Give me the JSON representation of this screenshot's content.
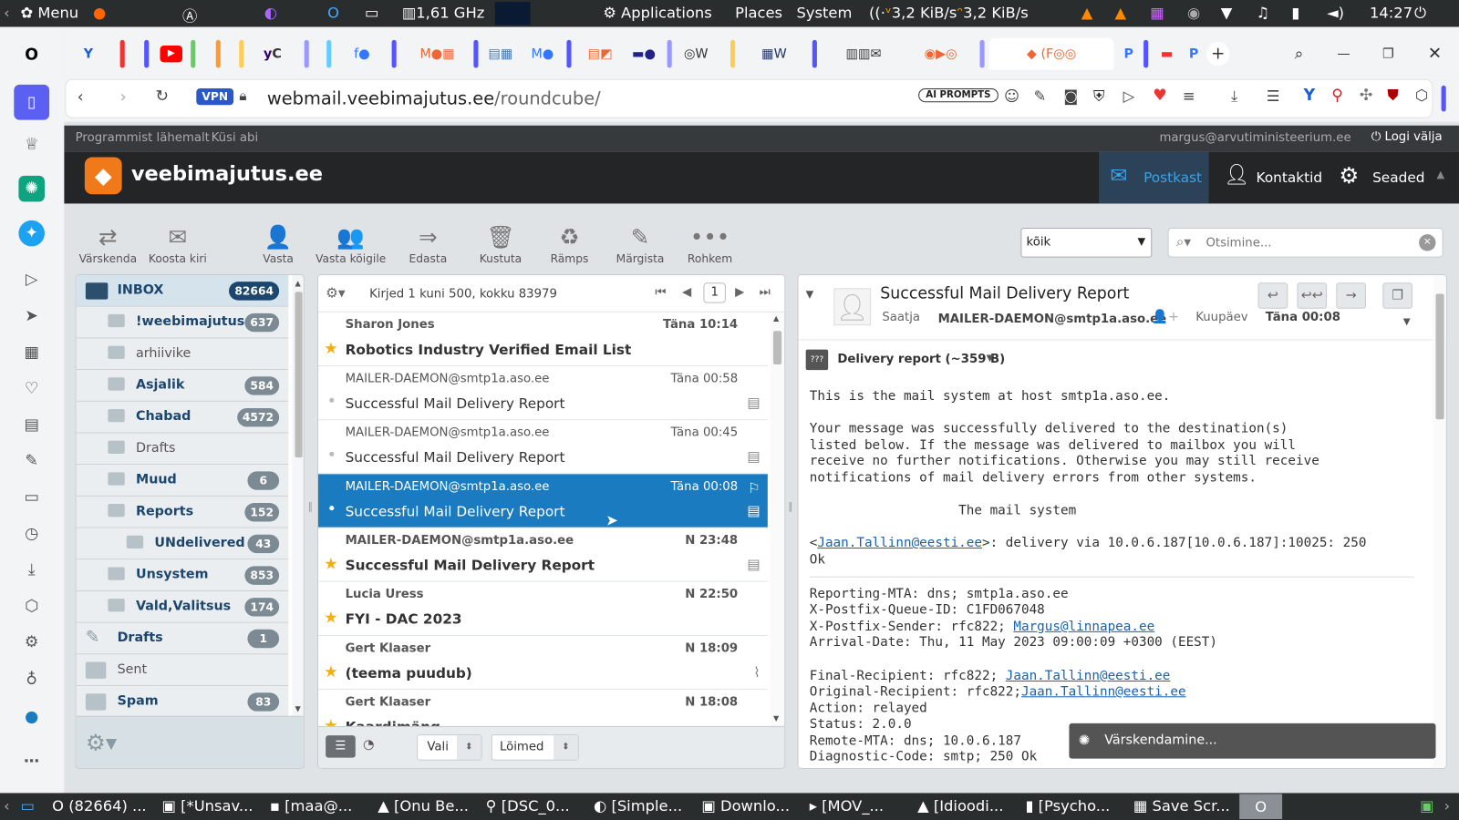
{
  "os": {
    "menu": "Menu",
    "cpu": "1,61 GHz",
    "applications": "Applications",
    "places": "Places",
    "system": "System",
    "netdown": "3,2 KiB/s",
    "netup": "3,2 KiB/s",
    "time": "14:27"
  },
  "browser": {
    "tabs_visible": [
      "X",
      "Y",
      "C",
      "W",
      "W",
      "P",
      "P"
    ],
    "url_host": "webmail.veebimajutus.ee",
    "url_path": "/roundcube/",
    "vpn": "VPN",
    "ai_prompts": "AI PROMPTS"
  },
  "rc": {
    "top_left": [
      "Programmist lähemalt",
      "Küsi abi"
    ],
    "user_email": "margus@arvutiministeerium.ee",
    "logout": "Logi välja",
    "logo_text": "veebimajutus.ee",
    "nav": [
      {
        "label": "Postkast"
      },
      {
        "label": "Kontaktid"
      },
      {
        "label": "Seaded"
      }
    ],
    "toolbar": [
      {
        "label": "Värskenda",
        "icon": "⇄"
      },
      {
        "label": "Koosta kiri",
        "icon": "✉"
      },
      {
        "label": "Vasta",
        "icon": "👤"
      },
      {
        "label": "Vasta kõigile",
        "icon": "👥"
      },
      {
        "label": "Edasta",
        "icon": "⇒"
      },
      {
        "label": "Kustuta",
        "icon": "🗑"
      },
      {
        "label": "Rämps",
        "icon": "♻"
      },
      {
        "label": "Märgista",
        "icon": "✎"
      },
      {
        "label": "Rohkem",
        "icon": "•••"
      }
    ],
    "filter_value": "kõik",
    "search_placeholder": "Otsimine...",
    "folders": [
      {
        "name": "INBOX",
        "count": "82664"
      },
      {
        "name": "!weebimajutus",
        "count": "637"
      },
      {
        "name": "arhiivike",
        "count": ""
      },
      {
        "name": "Asjalik",
        "count": "584"
      },
      {
        "name": "Chabad",
        "count": "4572"
      },
      {
        "name": "Drafts",
        "count": ""
      },
      {
        "name": "Muud",
        "count": "6"
      },
      {
        "name": "Reports",
        "count": "152"
      },
      {
        "name": "UNdelivered",
        "count": "43"
      },
      {
        "name": "Unsystem",
        "count": "853"
      },
      {
        "name": "Vald,Valitsus",
        "count": "174"
      },
      {
        "name": "Drafts",
        "count": "1"
      },
      {
        "name": "Sent",
        "count": ""
      },
      {
        "name": "Spam",
        "count": "83"
      }
    ],
    "list_info": "Kirjed 1 kuni 500, kokku 83979",
    "page": "1",
    "messages": [
      {
        "from": "Sharon Jones",
        "date": "Täna 10:14",
        "subject": "Robotics Industry Verified Email List"
      },
      {
        "from": "MAILER-DAEMON@smtp1a.aso.ee",
        "date": "Täna 00:58",
        "subject": "Successful Mail Delivery Report"
      },
      {
        "from": "MAILER-DAEMON@smtp1a.aso.ee",
        "date": "Täna 00:45",
        "subject": "Successful Mail Delivery Report"
      },
      {
        "from": "MAILER-DAEMON@smtp1a.aso.ee",
        "date": "Täna 00:08",
        "subject": "Successful Mail Delivery Report"
      },
      {
        "from": "MAILER-DAEMON@smtp1a.aso.ee",
        "date": "N 23:48",
        "subject": "Successful Mail Delivery Report"
      },
      {
        "from": "Lucia Uress",
        "date": "N 22:50",
        "subject": "FYI - DAC 2023"
      },
      {
        "from": "Gert Klaaser",
        "date": "N 18:09",
        "subject": "(teema puudub)"
      },
      {
        "from": "Gert Klaaser",
        "date": "N 18:08",
        "subject": "Kaardimäng"
      }
    ],
    "list_footer": {
      "select": "Vali",
      "threads": "Lõimed"
    },
    "preview": {
      "subject": "Successful Mail Delivery Report",
      "from_label": "Saatja",
      "from": "MAILER-DAEMON@smtp1a.aso.ee",
      "date_label": "Kuupäev",
      "date": "Täna 00:08",
      "attachment": "Delivery report (~359 B)",
      "body1": "This is the mail system at host smtp1a.aso.ee.\n\nYour message was successfully delivered to the destination(s)\nlisted below. If the message was delivered to mailbox you will\nreceive no further notifications. Otherwise you may still receive\nnotifications of mail delivery errors from other systems.\n\n                   The mail system",
      "recipient_link": "Jaan.Tallinn@eesti.ee",
      "delivery_line": ">: delivery via 10.0.6.187[10.0.6.187]:10025: 250",
      "ok": "Ok",
      "meta1": "Reporting-MTA: dns; smtp1a.aso.ee\nX-Postfix-Queue-ID: C1FD067048",
      "sender_prefix": "X-Postfix-Sender: rfc822; ",
      "sender_link": "Margus@linnapea.ee",
      "arrival": "Arrival-Date: Thu, 11 May 2023 09:00:09 +0300 (EEST)",
      "final_prefix": "Final-Recipient: rfc822; ",
      "orig_prefix": "Original-Recipient: rfc822;",
      "meta2": "Action: relayed\nStatus: 2.0.0\nRemote-MTA: dns; 10.0.6.187\nDiagnostic-Code: smtp; 250 Ok"
    },
    "toast": "Värskendamine..."
  },
  "taskbar": [
    "(82664) ...",
    "[*Unsav...",
    "[maa@...",
    "[Onu Be...",
    "[DSC_0...",
    "[Simple...",
    "Downlo...",
    "[MOV_...",
    "[Idioodi...",
    "[Psycho...",
    "Save Scr..."
  ]
}
